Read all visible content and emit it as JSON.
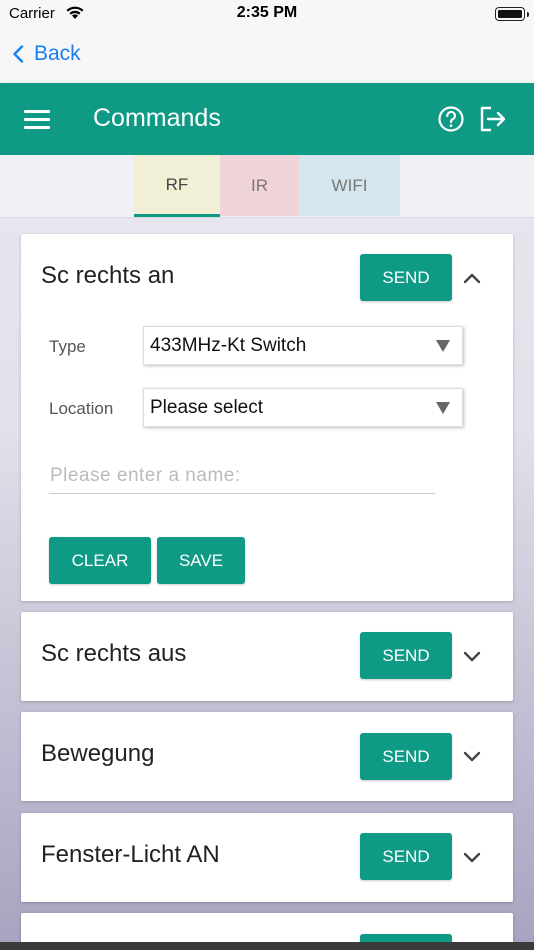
{
  "status_bar": {
    "carrier": "Carrier",
    "time": "2:35 PM"
  },
  "nav": {
    "back_label": "Back"
  },
  "toolbar": {
    "title": "Commands"
  },
  "tabs": [
    {
      "label": "RF",
      "active": true,
      "color": "#f1efd6"
    },
    {
      "label": "IR",
      "active": false,
      "color": "#f0d4da"
    },
    {
      "label": "WIFI",
      "active": false,
      "color": "#d4e7ee"
    }
  ],
  "theme": {
    "accent": "#0f9a85",
    "link": "#1a7ff0"
  },
  "commands": [
    {
      "title": "Sc rechts an",
      "send_label": "SEND",
      "expanded": true,
      "form": {
        "type_label": "Type",
        "type_value": "433MHz-Kt Switch",
        "location_label": "Location",
        "location_value": "Please select",
        "name_placeholder": "Please enter a name:",
        "clear_label": "CLEAR",
        "save_label": "SAVE"
      }
    },
    {
      "title": "Sc rechts aus",
      "send_label": "SEND",
      "expanded": false
    },
    {
      "title": "Bewegung",
      "send_label": "SEND",
      "expanded": false
    },
    {
      "title": "Fenster-Licht AN",
      "send_label": "SEND",
      "expanded": false
    },
    {
      "title": "",
      "send_label": "",
      "expanded": false
    }
  ]
}
